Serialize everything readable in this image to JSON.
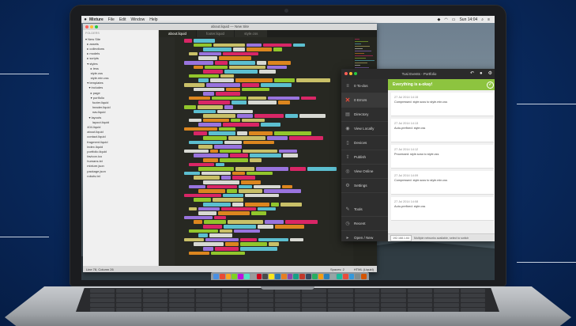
{
  "colors": {
    "background": "#0a2c63",
    "success": "#8dc43f",
    "error": "#e84b3a",
    "editor_bg": "#272822"
  },
  "menubar": {
    "app_name": "Mixture",
    "items": [
      "File",
      "Edit",
      "Window",
      "Help"
    ],
    "clock": "Sun 14:04"
  },
  "editor": {
    "title": "about.liquid — New Site",
    "tabs": [
      "about.liquid",
      "footer.liquid",
      "style.css"
    ],
    "sidebar_header": "FOLDERS",
    "tree": [
      "▾ New Site",
      "  ▸ assets",
      "  ▸ collections",
      "  ▸ models",
      "  ▸ scripts",
      "  ▾ styles",
      "      ▸ less",
      "      style.css",
      "      style.min.css",
      "  ▾ templates",
      "    ▾ includes",
      "      ▸ page",
      "      ▾ portfolio",
      "        footer.liquid",
      "        header.liquid",
      "        nav.liquid",
      "    ▾ layouts",
      "        layout.liquid",
      "  404.liquid",
      "  about.liquid",
      "  contact.liquid",
      "  fragment.liquid",
      "  index.liquid",
      "  portfolio.liquid",
      "  favicon.ico",
      "  humans.txt",
      "  mixture.json",
      "  package.json",
      "  robots.txt"
    ],
    "status_left": "Line 78, Column 26",
    "status_spaces": "Spaces: 2",
    "status_syntax": "HTML (Liquid)"
  },
  "prepros": {
    "title": "Tusi Events - Portfolio",
    "nav": [
      {
        "icon": "todo-icon",
        "glyph": "≡",
        "label": "0 To-dos"
      },
      {
        "icon": "error-x-icon",
        "glyph": "✕",
        "label": "0 Errors"
      },
      {
        "icon": "directory-icon",
        "glyph": "▤",
        "label": "Directory"
      },
      {
        "icon": "view-locally-icon",
        "glyph": "◉",
        "label": "View Locally"
      },
      {
        "icon": "devices-icon",
        "glyph": "▯",
        "label": "Devices"
      },
      {
        "icon": "publish-icon",
        "glyph": "⇪",
        "label": "Publish"
      },
      {
        "icon": "view-online-icon",
        "glyph": "◎",
        "label": "View Online"
      },
      {
        "icon": "settings-icon",
        "glyph": "⚙",
        "label": "Settings"
      },
      {
        "icon": "tools-icon",
        "glyph": "✎",
        "label": "Tools"
      },
      {
        "icon": "recent-icon",
        "glyph": "◷",
        "label": "Recent"
      },
      {
        "icon": "open-new-icon",
        "glyph": "▸",
        "label": "Open / New"
      }
    ],
    "banner": "Everything is a-okay!",
    "logs": [
      {
        "date": "27 Jul 2014 14:15",
        "text": "Compressed: style.scss to style.min.css"
      },
      {
        "date": "27 Jul 2014 14:13",
        "text": "Auto-prefixed: style.css"
      },
      {
        "date": "27 Jul 2014 14:12",
        "text": "Processed: style.scss to style.css"
      },
      {
        "date": "27 Jul 2014 14:09",
        "text": "Compressed: style.scss to style.min.css"
      },
      {
        "date": "27 Jul 2014 14:08",
        "text": "Auto-prefixed: style.css"
      }
    ],
    "footer_ip": "192.168.1.64",
    "footer_text": "Multiple networks available, select to switch"
  }
}
